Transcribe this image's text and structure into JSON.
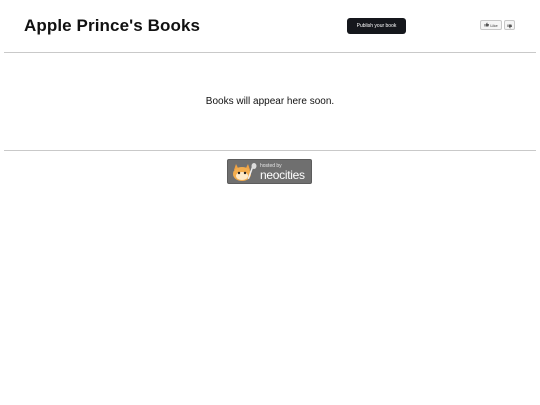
{
  "header": {
    "title": "Apple Prince's Books",
    "publish_label": "Publish your book",
    "like_label": "Like"
  },
  "main": {
    "empty_message": "Books will appear here soon."
  },
  "footer": {
    "badge": {
      "small_text": "hosted by",
      "brand_text": "neocities"
    }
  },
  "icons": {
    "like": "thumbs-up-icon",
    "dislike": "thumbs-down-icon",
    "badge_mascot": "neocities-cat-icon"
  },
  "colors": {
    "publish_button_bg": "#15171c",
    "badge_bg": "#6f6f6f",
    "rule": "#c9c9c9"
  }
}
